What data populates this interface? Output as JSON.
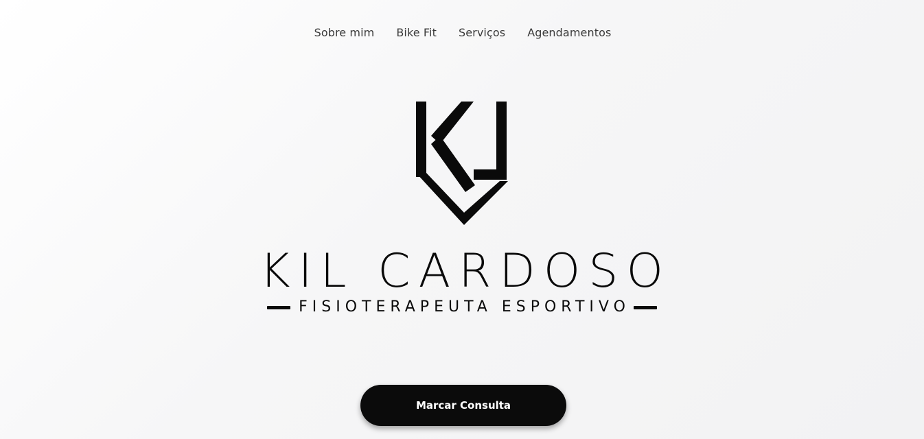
{
  "nav": {
    "items": [
      {
        "label": "Sobre mim"
      },
      {
        "label": "Bike Fit"
      },
      {
        "label": "Serviços"
      },
      {
        "label": "Agendamentos"
      }
    ]
  },
  "brand": {
    "name": "KIL CARDOSO",
    "tagline": "FISIOTERAPEUTA ESPORTIVO",
    "emblem_icon": "kc-monogram-icon",
    "color": "#0a0a0a"
  },
  "cta": {
    "label": "Marcar Consulta",
    "background": "#0b0b0b",
    "text_color": "#ffffff"
  },
  "theme": {
    "background": "#f5f5f6",
    "nav_text": "#3a3a3a"
  }
}
